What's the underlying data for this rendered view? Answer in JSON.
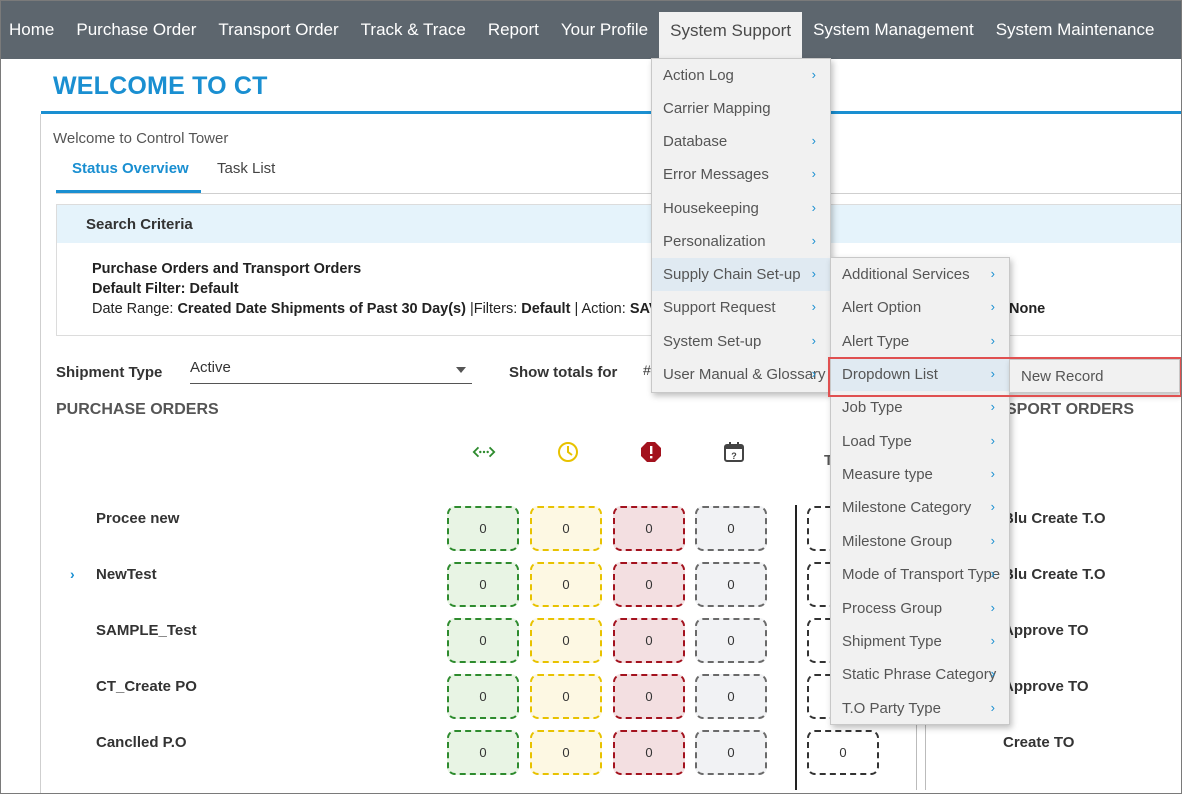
{
  "nav": {
    "items": [
      "Home",
      "Purchase Order",
      "Transport Order",
      "Track & Trace",
      "Report",
      "Your Profile",
      "System Support",
      "System Management",
      "System Maintenance"
    ]
  },
  "page": {
    "title": "WELCOME TO CT",
    "welcome": "Welcome to Control Tower"
  },
  "tabs": [
    "Status Overview",
    "Task List"
  ],
  "criteria": {
    "heading": "Search Criteria",
    "line1": "Purchase Orders and Transport Orders",
    "line2": "Default Filter: Default",
    "line3_prefix": "Date Range: ",
    "line3_range": "Created Date Shipments of Past 30 Day(s)",
    "line3_filters_label": " |Filters: ",
    "line3_filters": "Default",
    "line3_action_label": " | Action: ",
    "line3_action": "SAV",
    "line3_tail": "None"
  },
  "controls": {
    "shipment_type_label": "Shipment Type",
    "shipment_type_value": "Active",
    "show_totals_label": "Show totals for",
    "show_totals_value": "#"
  },
  "sections": {
    "purchase_orders": "PURCHASE ORDERS",
    "transport_orders": "SPORT ORDERS",
    "t_header": "T"
  },
  "icons": [
    "route-icon",
    "clock-icon",
    "error-icon",
    "calendar-question-icon"
  ],
  "colors": {
    "accent": "#1a8fd1",
    "nav_bg": "#5d666e",
    "green": "#2e8b2e",
    "yellow": "#e8c200",
    "red": "#a3121e",
    "grey": "#6a6a6a",
    "highlight": "#e05050"
  },
  "po_rows": [
    {
      "label": "Procee new",
      "values": [
        "0",
        "0",
        "0",
        "0"
      ]
    },
    {
      "label": "NewTest",
      "values": [
        "0",
        "0",
        "0",
        "0"
      ]
    },
    {
      "label": "SAMPLE_Test",
      "values": [
        "0",
        "0",
        "0",
        "0"
      ]
    },
    {
      "label": "CT_Create PO",
      "values": [
        "0",
        "0",
        "0",
        "0"
      ]
    },
    {
      "label": "Canclled P.O",
      "values": [
        "0",
        "0",
        "0",
        "0"
      ]
    }
  ],
  "to_rows": [
    "Blu Create T.O",
    "Blu Create T.O",
    "Approve TO",
    "Approve TO",
    "Create TO"
  ],
  "to_last_value": "0",
  "menu_system_support": [
    {
      "label": "Action Log",
      "sub": true
    },
    {
      "label": "Carrier Mapping",
      "sub": false
    },
    {
      "label": "Database",
      "sub": true
    },
    {
      "label": "Error Messages",
      "sub": true
    },
    {
      "label": "Housekeeping",
      "sub": true
    },
    {
      "label": "Personalization",
      "sub": true
    },
    {
      "label": "Supply Chain Set-up",
      "sub": true
    },
    {
      "label": "Support Request",
      "sub": true
    },
    {
      "label": "System Set-up",
      "sub": true
    },
    {
      "label": "User Manual & Glossary",
      "sub": true
    }
  ],
  "menu_supply_chain": [
    "Additional Services",
    "Alert Option",
    "Alert Type",
    "Dropdown List",
    "Job Type",
    "Load Type",
    "Measure type",
    "Milestone Category",
    "Milestone Group",
    "Mode of Transport Type",
    "Process Group",
    "Shipment Type",
    "Static Phrase Category",
    "T.O Party Type"
  ],
  "menu_dropdown_list": [
    "New Record"
  ],
  "chevron": "›"
}
